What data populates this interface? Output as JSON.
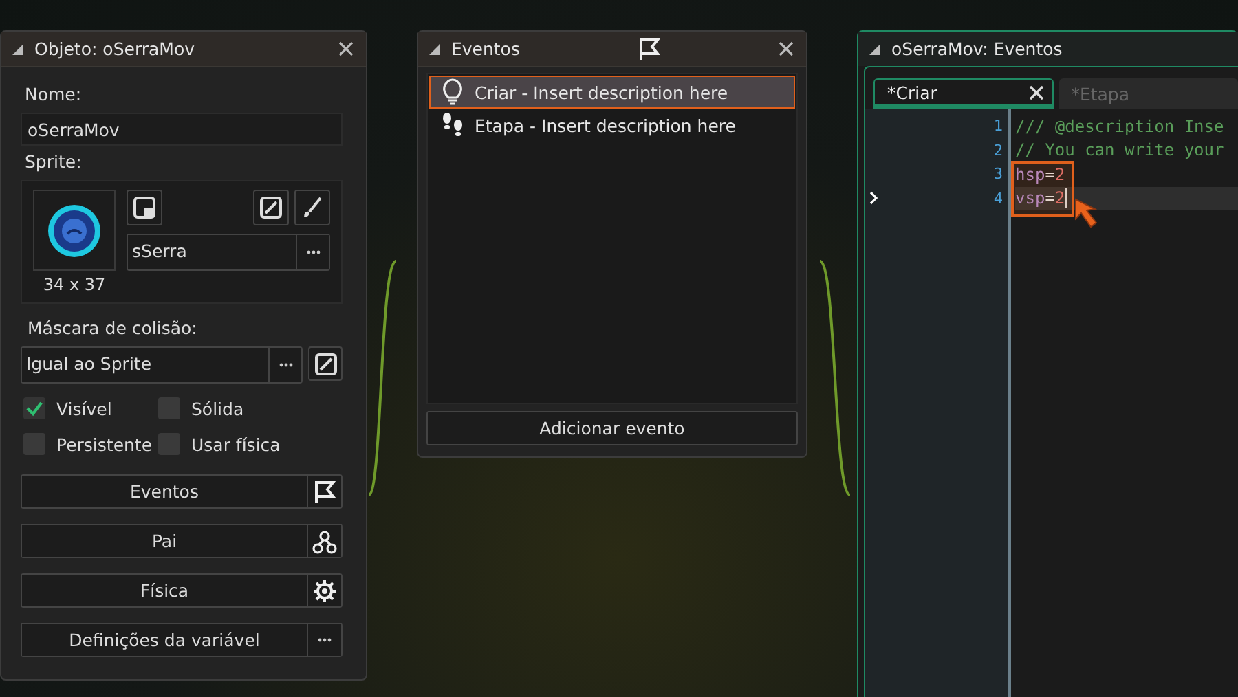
{
  "object_panel": {
    "title": "Objeto: oSerraMov",
    "name_label": "Nome:",
    "name_value": "oSerraMov",
    "sprite_label": "Sprite:",
    "sprite_name": "sSerra",
    "sprite_size": "34 x 37",
    "mask_label": "Máscara de colisão:",
    "mask_value": "Igual ao Sprite",
    "checkboxes": [
      {
        "label": "Visível",
        "checked": true
      },
      {
        "label": "Sólida",
        "checked": false
      },
      {
        "label": "Persistente",
        "checked": false
      },
      {
        "label": "Usar física",
        "checked": false
      }
    ],
    "buttons": [
      {
        "label": "Eventos",
        "kind": "flag"
      },
      {
        "label": "Pai",
        "kind": "nodes"
      },
      {
        "label": "Física",
        "kind": "gear"
      },
      {
        "label": "Definições da variável",
        "kind": "dots"
      }
    ]
  },
  "events_panel": {
    "title": "Eventos",
    "events": [
      {
        "label": "Criar - Insert description here",
        "kind": "bulb",
        "selected": true
      },
      {
        "label": "Etapa - Insert description here",
        "kind": "steps",
        "selected": false
      }
    ],
    "add_button": "Adicionar evento"
  },
  "code_panel": {
    "title": "oSerraMov: Eventos",
    "tabs": [
      {
        "label": "*Criar",
        "selected": true
      },
      {
        "label": "*Etapa",
        "selected": false
      }
    ],
    "lines": [
      {
        "number": "1",
        "current": false,
        "tokens": [
          {
            "kind": "comment",
            "text": "/// @description Inse"
          }
        ]
      },
      {
        "number": "2",
        "current": false,
        "tokens": [
          {
            "kind": "comment",
            "text": "// You can write your"
          }
        ]
      },
      {
        "number": "3",
        "current": false,
        "tokens": [
          {
            "kind": "variable",
            "text": "hsp"
          },
          {
            "kind": "operator",
            "text": "="
          },
          {
            "kind": "number",
            "text": "2"
          }
        ]
      },
      {
        "number": "4",
        "current": true,
        "tokens": [
          {
            "kind": "variable",
            "text": "vsp"
          },
          {
            "kind": "operator",
            "text": "="
          },
          {
            "kind": "number",
            "text": "2"
          }
        ]
      }
    ]
  }
}
